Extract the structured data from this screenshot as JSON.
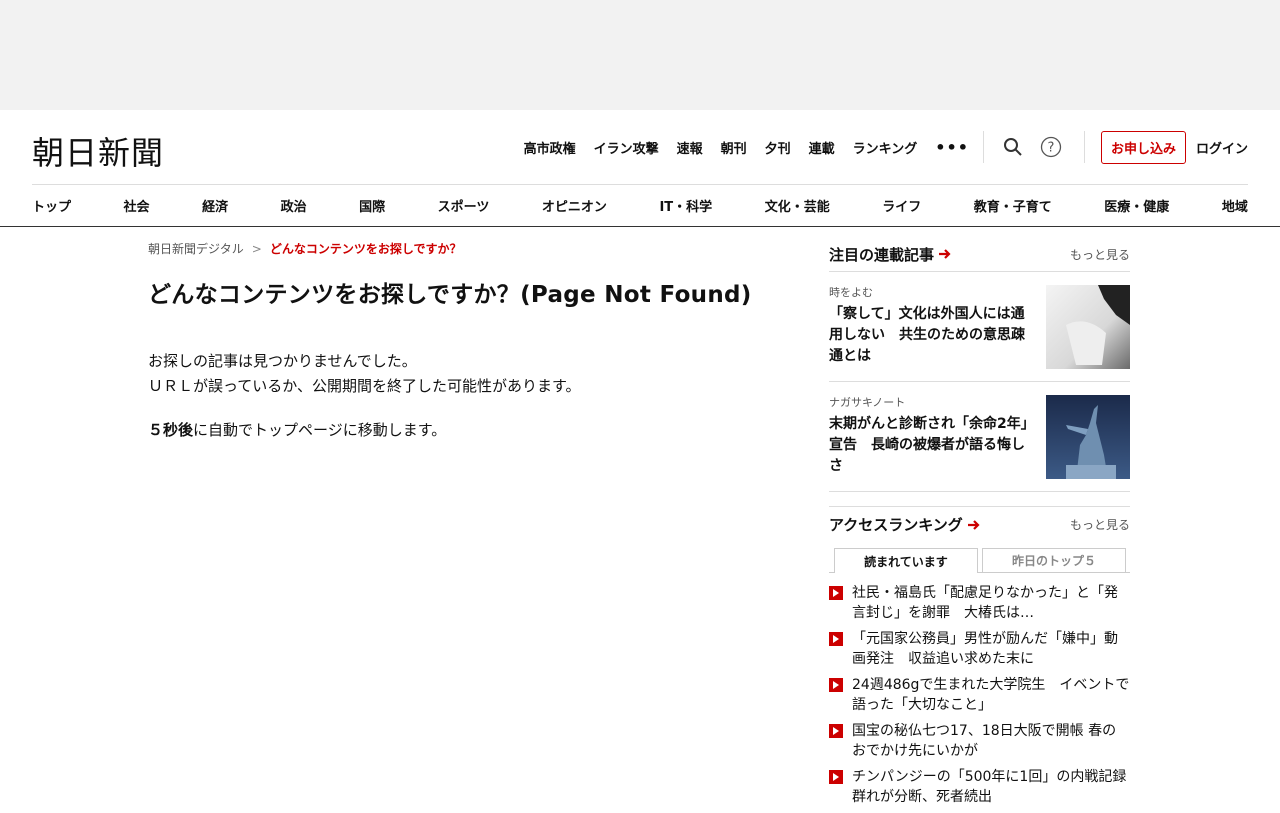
{
  "header": {
    "logo": "朝日新聞",
    "top_links": [
      "高市政権",
      "イラン攻撃",
      "速報",
      "朝刊",
      "夕刊",
      "連載",
      "ランキング"
    ],
    "subscribe_label": "お申し込み",
    "login_label": "ログイン"
  },
  "nav": {
    "items": [
      "トップ",
      "社会",
      "経済",
      "政治",
      "国際",
      "スポーツ",
      "オピニオン",
      "IT・科学",
      "文化・芸能",
      "ライフ",
      "教育・子育て",
      "医療・健康",
      "地域"
    ]
  },
  "breadcrumb": {
    "home": "朝日新聞デジタル",
    "separator": ">",
    "current": "どんなコンテンツをお探しですか？"
  },
  "main": {
    "title": "どんなコンテンツをお探しですか？(Page Not Found)",
    "message_line1": "お探しの記事は見つかりませんでした。",
    "message_line2": "ＵＲＬが誤っているか、公開期間を終了した可能性があります。",
    "redirect_bold": "５秒後",
    "redirect_rest": "に自動でトップページに移動します。"
  },
  "side": {
    "series_title": "注目の連載記事",
    "more_label": "もっと見る",
    "articles": [
      {
        "category": "時をよむ",
        "headline": "「察して」文化は外国人には通用しない　共生のための意思疎通とは"
      },
      {
        "category": "ナガサキノート",
        "headline": "末期がんと診断され「余命2年」宣告　長崎の被爆者が語る悔しさ"
      }
    ],
    "ranking_title": "アクセスランキング",
    "tabs": [
      "読まれています",
      "昨日のトップ５"
    ],
    "ranking": [
      "社民・福島氏「配慮足りなかった」と「発言封じ」を謝罪　大椿氏は…",
      "「元国家公務員」男性が励んだ「嫌中」動画発注　収益追い求めた末に",
      "24週486gで生まれた大学院生　イベントで語った「大切なこと」",
      "国宝の秘仏七つ17、18日大阪で開帳 春のおでかけ先にいかが",
      "チンパンジーの「500年に1回」の内戦記録　群れが分断、死者続出"
    ]
  },
  "colors": {
    "accent": "#cc0000",
    "text": "#111111",
    "muted": "#555555"
  }
}
